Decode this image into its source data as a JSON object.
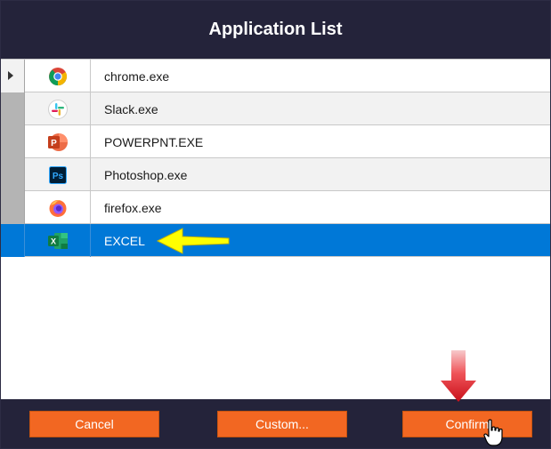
{
  "window": {
    "title": "Application List"
  },
  "apps": [
    {
      "name": "chrome.exe",
      "icon": "chrome-icon"
    },
    {
      "name": "Slack.exe",
      "icon": "slack-icon"
    },
    {
      "name": "POWERPNT.EXE",
      "icon": "powerpoint-icon"
    },
    {
      "name": "Photoshop.exe",
      "icon": "photoshop-icon"
    },
    {
      "name": "firefox.exe",
      "icon": "firefox-icon"
    },
    {
      "name": "EXCEL",
      "icon": "excel-icon"
    }
  ],
  "selected_app": "EXCEL",
  "buttons": {
    "cancel": "Cancel",
    "custom": "Custom...",
    "confirm": "Confirm"
  },
  "colors": {
    "titlebar": "#24233a",
    "button": "#f26722",
    "selection": "#0078d7",
    "callout_arrow": "#ffff00",
    "down_arrow": "#e0151c"
  }
}
